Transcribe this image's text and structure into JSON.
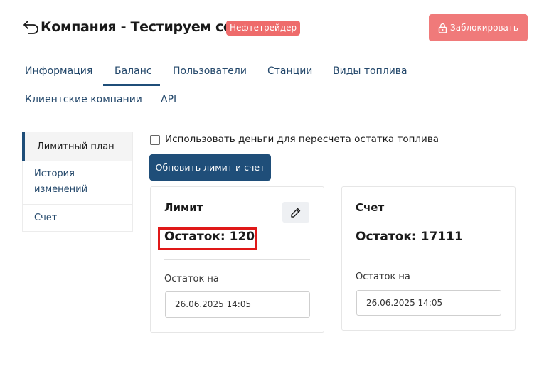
{
  "header": {
    "title": "Компания - Тестируем сервис",
    "badge": "Нефтетрейдер",
    "block_button": "Заблокировать"
  },
  "tabs": [
    {
      "label": "Информация"
    },
    {
      "label": "Баланс",
      "active": true
    },
    {
      "label": "Пользователи"
    },
    {
      "label": "Станции"
    },
    {
      "label": "Виды топлива"
    },
    {
      "label": "Клиентские компании"
    },
    {
      "label": "API"
    }
  ],
  "sidebar": {
    "items": [
      {
        "label": "Лимитный план",
        "active": true
      },
      {
        "label": "История изменений"
      },
      {
        "label": "Счет"
      }
    ]
  },
  "main": {
    "checkbox_label": "Использовать деньги для пересчета остатка топлива",
    "checkbox_checked": false,
    "update_button": "Обновить лимит и счет",
    "limit_card": {
      "title": "Лимит",
      "balance": "Остаток: 120",
      "date_label": "Остаток на",
      "date_value": "26.06.2025 14:05"
    },
    "account_card": {
      "title": "Счет",
      "balance": "Остаток: 17111",
      "date_label": "Остаток на",
      "date_value": "26.06.2025 14:05"
    }
  },
  "colors": {
    "primary": "#1f4e79",
    "danger": "#f07a7a",
    "badge": "#ee6b6b",
    "highlight": "#e01818"
  },
  "icons": {
    "back": "back-arrow-icon",
    "lock": "lock-icon",
    "edit": "pencil-icon"
  }
}
